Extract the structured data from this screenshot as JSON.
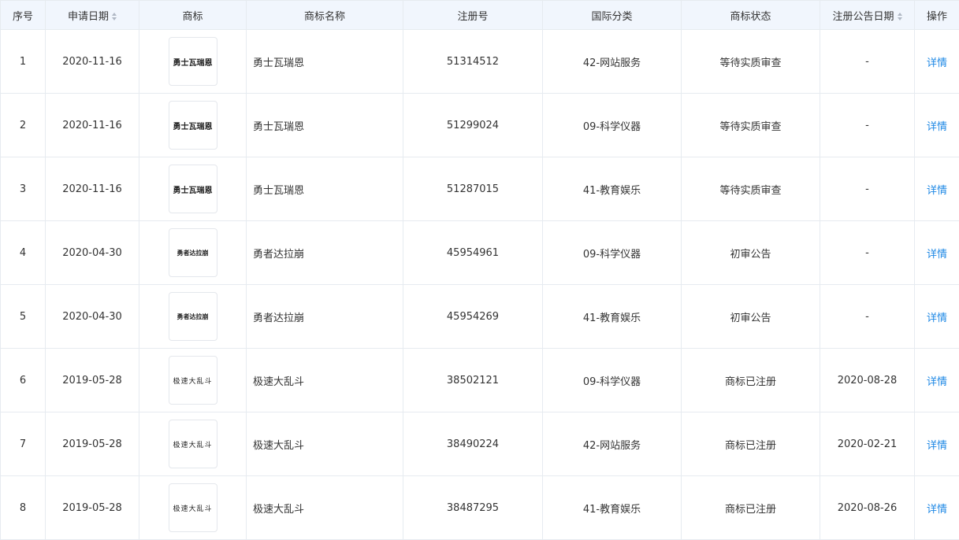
{
  "headers": {
    "index": "序号",
    "apply_date": "申请日期",
    "logo": "商标",
    "name": "商标名称",
    "reg_no": "注册号",
    "class": "国际分类",
    "status": "商标状态",
    "pub_date": "注册公告日期",
    "action": "操作"
  },
  "action_label": "详情",
  "colors": {
    "header_bg": "#f1f6fd",
    "link": "#1e88e5",
    "border": "#e6ebf0"
  },
  "rows": [
    {
      "index": "1",
      "apply_date": "2020-11-16",
      "logo_text": "勇士瓦瑞恩",
      "name": "勇士瓦瑞恩",
      "reg_no": "51314512",
      "class": "42-网站服务",
      "status": "等待实质审查",
      "pub_date": "-"
    },
    {
      "index": "2",
      "apply_date": "2020-11-16",
      "logo_text": "勇士瓦瑞恩",
      "name": "勇士瓦瑞恩",
      "reg_no": "51299024",
      "class": "09-科学仪器",
      "status": "等待实质审查",
      "pub_date": "-"
    },
    {
      "index": "3",
      "apply_date": "2020-11-16",
      "logo_text": "勇士瓦瑞恩",
      "name": "勇士瓦瑞恩",
      "reg_no": "51287015",
      "class": "41-教育娱乐",
      "status": "等待实质审查",
      "pub_date": "-"
    },
    {
      "index": "4",
      "apply_date": "2020-04-30",
      "logo_text": "勇者达拉崩",
      "name": "勇者达拉崩",
      "reg_no": "45954961",
      "class": "09-科学仪器",
      "status": "初审公告",
      "pub_date": "-"
    },
    {
      "index": "5",
      "apply_date": "2020-04-30",
      "logo_text": "勇者达拉崩",
      "name": "勇者达拉崩",
      "reg_no": "45954269",
      "class": "41-教育娱乐",
      "status": "初审公告",
      "pub_date": "-"
    },
    {
      "index": "6",
      "apply_date": "2019-05-28",
      "logo_text": "极速大乱斗",
      "name": "极速大乱斗",
      "reg_no": "38502121",
      "class": "09-科学仪器",
      "status": "商标已注册",
      "pub_date": "2020-08-28"
    },
    {
      "index": "7",
      "apply_date": "2019-05-28",
      "logo_text": "极速大乱斗",
      "name": "极速大乱斗",
      "reg_no": "38490224",
      "class": "42-网站服务",
      "status": "商标已注册",
      "pub_date": "2020-02-21"
    },
    {
      "index": "8",
      "apply_date": "2019-05-28",
      "logo_text": "极速大乱斗",
      "name": "极速大乱斗",
      "reg_no": "38487295",
      "class": "41-教育娱乐",
      "status": "商标已注册",
      "pub_date": "2020-08-26"
    }
  ]
}
